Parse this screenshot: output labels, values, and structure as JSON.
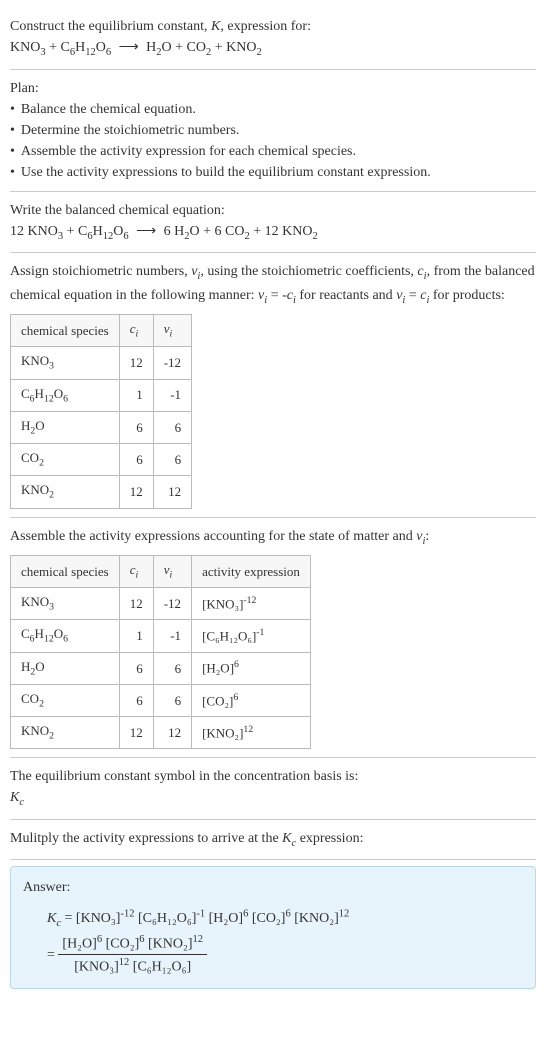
{
  "header": {
    "prompt": "Construct the equilibrium constant, K, expression for:",
    "equation_lhs": "KNO₃ + C₆H₁₂O₆",
    "arrow": "⟶",
    "equation_rhs": "H₂O + CO₂ + KNO₂"
  },
  "plan": {
    "label": "Plan:",
    "items": [
      "Balance the chemical equation.",
      "Determine the stoichiometric numbers.",
      "Assemble the activity expression for each chemical species.",
      "Use the activity expressions to build the equilibrium constant expression."
    ]
  },
  "balanced": {
    "label": "Write the balanced chemical equation:",
    "equation_lhs": "12 KNO₃ + C₆H₁₂O₆",
    "arrow": "⟶",
    "equation_rhs": "6 H₂O + 6 CO₂ + 12 KNO₂"
  },
  "stoich": {
    "text": "Assign stoichiometric numbers, νᵢ, using the stoichiometric coefficients, cᵢ, from the balanced chemical equation in the following manner: νᵢ = -cᵢ for reactants and νᵢ = cᵢ for products:",
    "headers": {
      "h1": "chemical species",
      "h2": "cᵢ",
      "h3": "νᵢ"
    },
    "rows": [
      {
        "species": "KNO₃",
        "c": "12",
        "v": "-12"
      },
      {
        "species": "C₆H₁₂O₆",
        "c": "1",
        "v": "-1"
      },
      {
        "species": "H₂O",
        "c": "6",
        "v": "6"
      },
      {
        "species": "CO₂",
        "c": "6",
        "v": "6"
      },
      {
        "species": "KNO₂",
        "c": "12",
        "v": "12"
      }
    ]
  },
  "activity": {
    "text": "Assemble the activity expressions accounting for the state of matter and νᵢ:",
    "headers": {
      "h1": "chemical species",
      "h2": "cᵢ",
      "h3": "νᵢ",
      "h4": "activity expression"
    },
    "rows": [
      {
        "species": "KNO₃",
        "c": "12",
        "v": "-12",
        "expr_base": "[KNO₃]",
        "expr_sup": "-12"
      },
      {
        "species": "C₆H₁₂O₆",
        "c": "1",
        "v": "-1",
        "expr_base": "[C₆H₁₂O₆]",
        "expr_sup": "-1"
      },
      {
        "species": "H₂O",
        "c": "6",
        "v": "6",
        "expr_base": "[H₂O]",
        "expr_sup": "6"
      },
      {
        "species": "CO₂",
        "c": "6",
        "v": "6",
        "expr_base": "[CO₂]",
        "expr_sup": "6"
      },
      {
        "species": "KNO₂",
        "c": "12",
        "v": "12",
        "expr_base": "[KNO₂]",
        "expr_sup": "12"
      }
    ]
  },
  "symbol": {
    "text": "The equilibrium constant symbol in the concentration basis is:",
    "value_base": "K",
    "value_sub": "c"
  },
  "multiply": {
    "text_a": "Mulitply the activity expressions to arrive at the ",
    "k_base": "K",
    "k_sub": "c",
    "text_b": " expression:"
  },
  "answer": {
    "label": "Answer:",
    "k_base": "K",
    "k_sub": "c",
    "eq": " = ",
    "line1": {
      "t1_base": "[KNO₃]",
      "t1_sup": "-12",
      "t2_base": "[C₆H₁₂O₆]",
      "t2_sup": "-1",
      "t3_base": "[H₂O]",
      "t3_sup": "6",
      "t4_base": "[CO₂]",
      "t4_sup": "6",
      "t5_base": "[KNO₂]",
      "t5_sup": "12"
    },
    "eq2": "= ",
    "frac": {
      "num": {
        "a_base": "[H₂O]",
        "a_sup": "6",
        "b_base": "[CO₂]",
        "b_sup": "6",
        "c_base": "[KNO₂]",
        "c_sup": "12"
      },
      "den": {
        "a_base": "[KNO₃]",
        "a_sup": "12",
        "b_base": "[C₆H₁₂O₆]",
        "b_sup": ""
      }
    }
  },
  "chart_data": {
    "type": "table",
    "tables": [
      {
        "title": "Stoichiometric numbers",
        "columns": [
          "chemical species",
          "c_i",
          "ν_i"
        ],
        "rows": [
          [
            "KNO3",
            12,
            -12
          ],
          [
            "C6H12O6",
            1,
            -1
          ],
          [
            "H2O",
            6,
            6
          ],
          [
            "CO2",
            6,
            6
          ],
          [
            "KNO2",
            12,
            12
          ]
        ]
      },
      {
        "title": "Activity expressions",
        "columns": [
          "chemical species",
          "c_i",
          "ν_i",
          "activity expression"
        ],
        "rows": [
          [
            "KNO3",
            12,
            -12,
            "[KNO3]^-12"
          ],
          [
            "C6H12O6",
            1,
            -1,
            "[C6H12O6]^-1"
          ],
          [
            "H2O",
            6,
            6,
            "[H2O]^6"
          ],
          [
            "CO2",
            6,
            6,
            "[CO2]^6"
          ],
          [
            "KNO2",
            12,
            12,
            "[KNO2]^12"
          ]
        ]
      }
    ]
  }
}
